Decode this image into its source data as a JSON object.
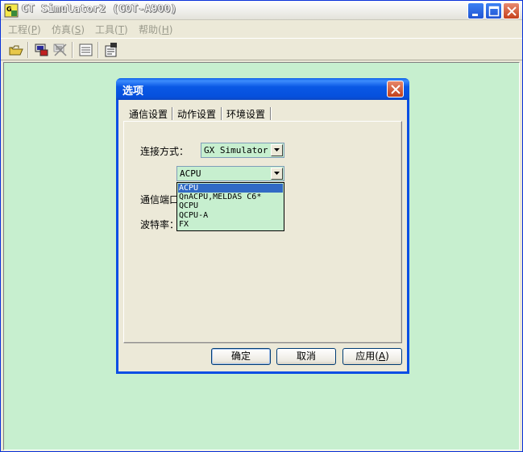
{
  "window": {
    "title": "GT Simulator2 (GOT-A900)"
  },
  "menubar": {
    "items": [
      {
        "label": "工程",
        "mnemonic": "P"
      },
      {
        "label": "仿真",
        "mnemonic": "S"
      },
      {
        "label": "工具",
        "mnemonic": "T"
      },
      {
        "label": "帮助",
        "mnemonic": "H"
      }
    ]
  },
  "toolbar": {
    "icons": [
      "open-folder-icon",
      "connect-plc-icon",
      "disconnect-plc-icon",
      "device-list-icon",
      "options-icon"
    ]
  },
  "dialog": {
    "title": "选项",
    "tabs": [
      "通信设置",
      "动作设置",
      "环境设置"
    ],
    "active_tab": 0,
    "connection_label": "连接方式：",
    "connection_value": "GX Simulator",
    "cpu_value": "ACPU",
    "port_label": "通信端口",
    "baud_label": "波特率：",
    "cpu_options": [
      "ACPU",
      "QnACPU,MELDAS C6*",
      "QCPU",
      "QCPU-A",
      "FX"
    ],
    "cpu_selected_index": 0,
    "ok_label": "确定",
    "cancel_label": "取消",
    "apply_label": "应用",
    "apply_mnemonic": "A"
  },
  "colors": {
    "client_background": "#c7efcf",
    "dialog_titlebar": "#0a5fe8",
    "selection": "#316ac5"
  }
}
